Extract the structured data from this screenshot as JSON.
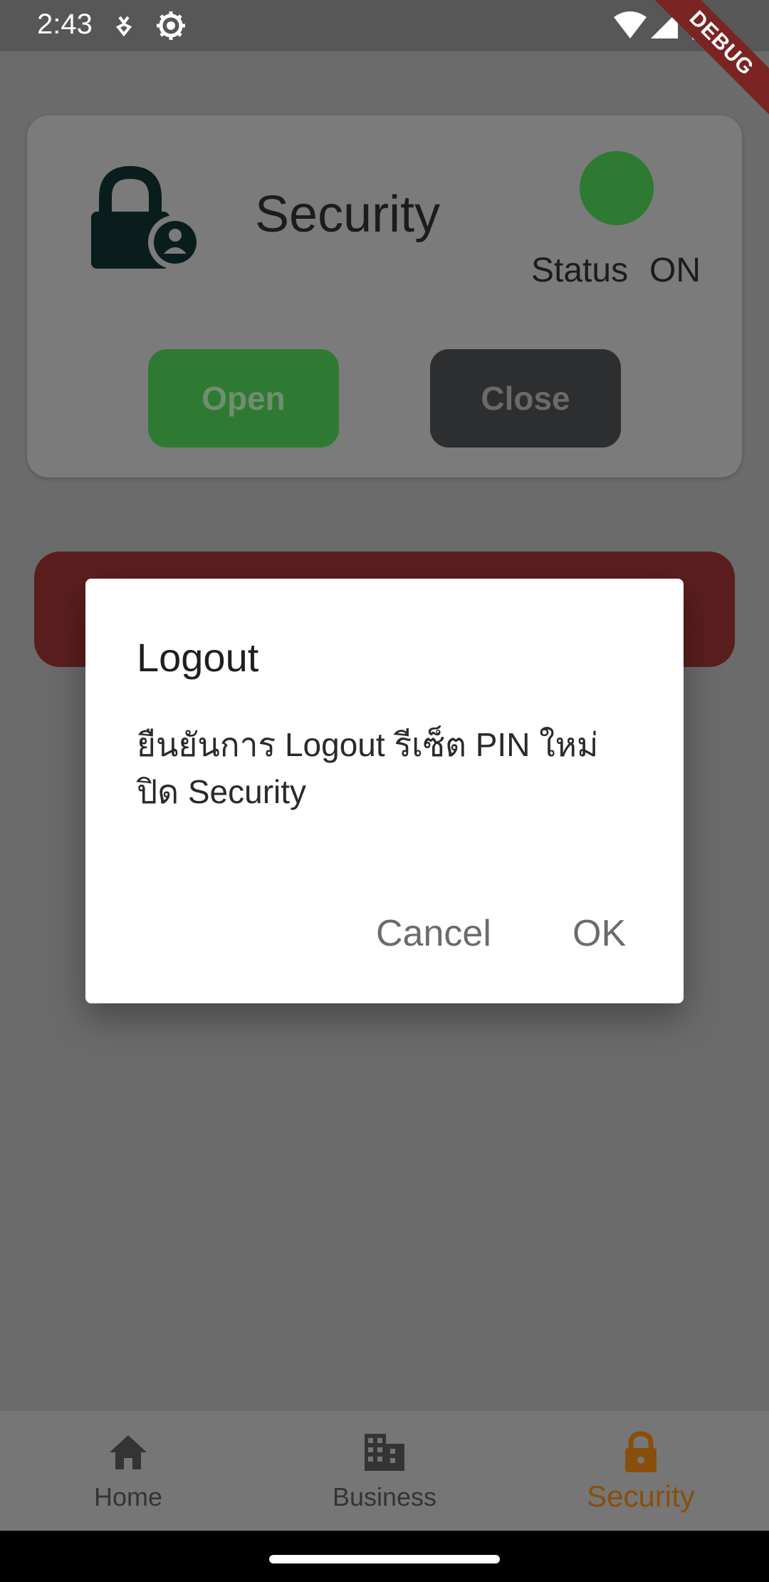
{
  "status_bar": {
    "time": "2:43",
    "icons": [
      "download-icon",
      "settings-gear-icon",
      "wifi-icon",
      "signal-icon",
      "battery-icon"
    ],
    "debug_label": "DEBUG"
  },
  "security_card": {
    "title": "Security",
    "status_label": "Status",
    "status_value": "ON",
    "status_color": "#2e7a32",
    "open_button": "Open",
    "close_button": "Close"
  },
  "dialog": {
    "title": "Logout",
    "message": "ยืนยันการ Logout รีเซ็ต PIN ใหม่ ปิด Security",
    "cancel_label": "Cancel",
    "ok_label": "OK"
  },
  "bottom_nav": {
    "items": [
      {
        "label": "Home",
        "icon": "home-icon",
        "active": false
      },
      {
        "label": "Business",
        "icon": "business-icon",
        "active": false
      },
      {
        "label": "Security",
        "icon": "lock-icon",
        "active": true
      }
    ],
    "active_color": "#8a4e0b"
  }
}
